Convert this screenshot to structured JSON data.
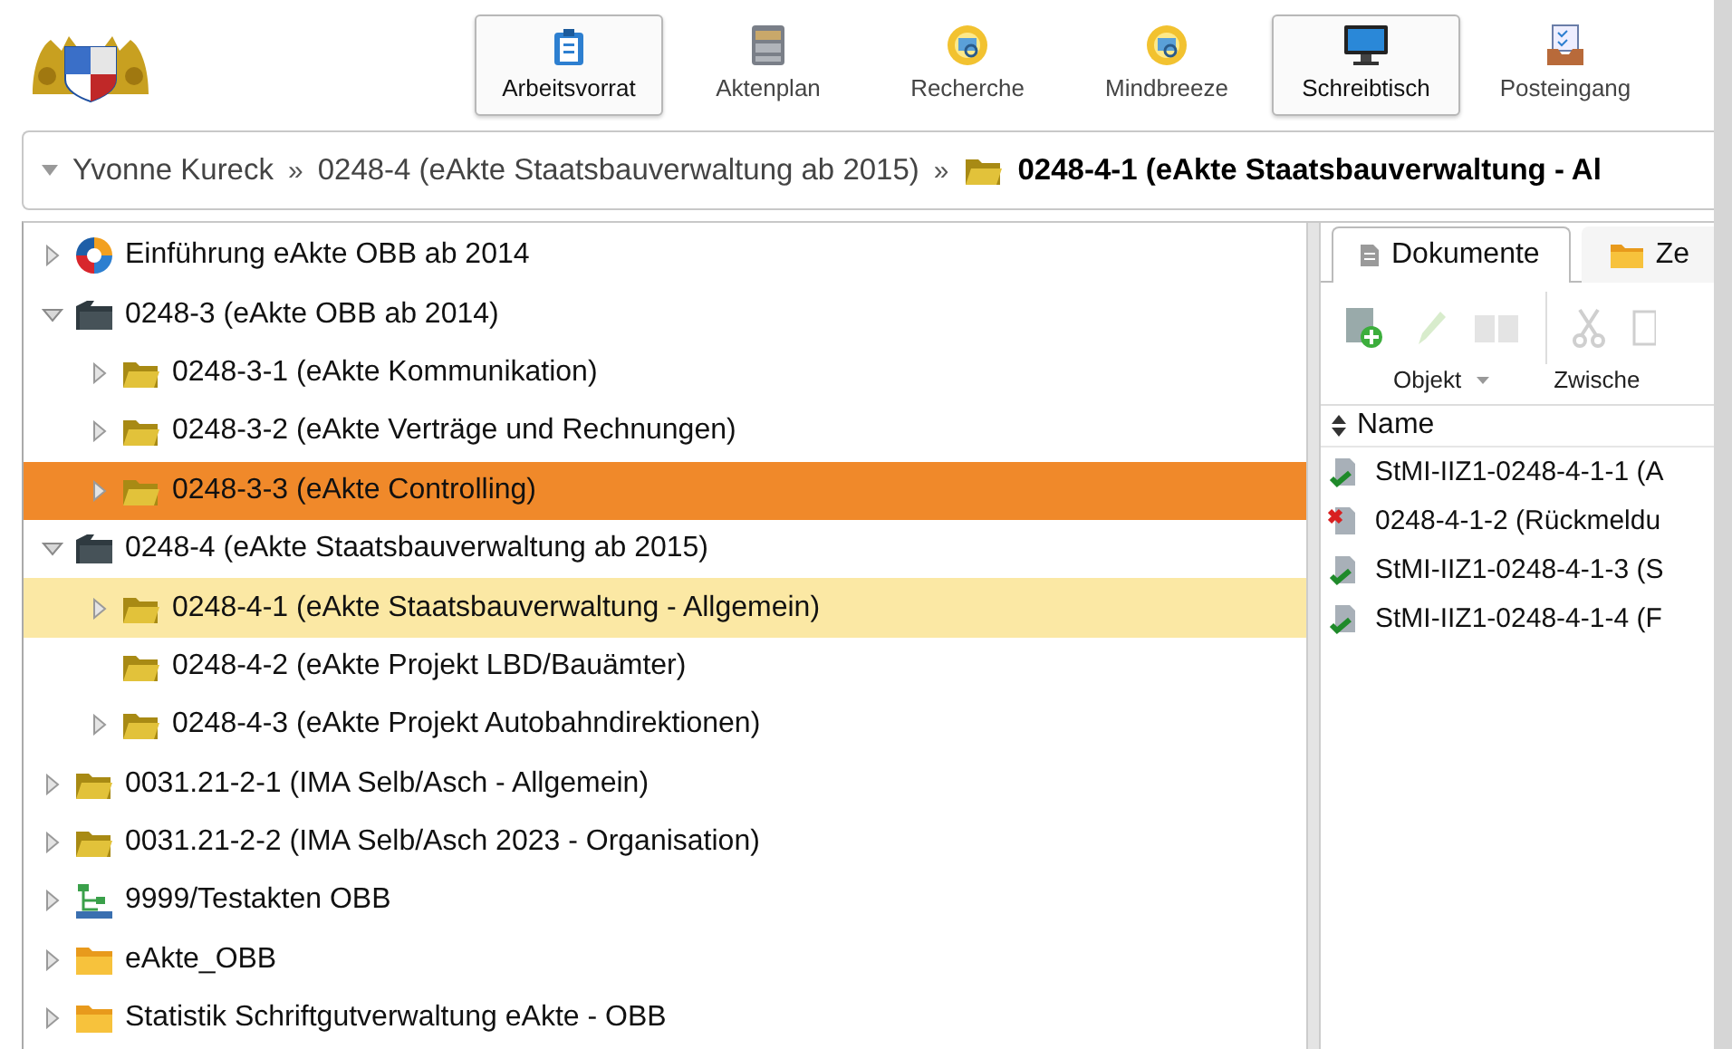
{
  "toolbar": [
    {
      "label": "Arbeitsvorrat",
      "kind": "clipboard",
      "selected": true
    },
    {
      "label": "Aktenplan",
      "kind": "cabinet",
      "selected": false
    },
    {
      "label": "Recherche",
      "kind": "search",
      "selected": false
    },
    {
      "label": "Mindbreeze",
      "kind": "search",
      "selected": false
    },
    {
      "label": "Schreibtisch",
      "kind": "monitor",
      "selected": true
    },
    {
      "label": "Posteingang",
      "kind": "inbox",
      "selected": false
    }
  ],
  "breadcrumb": {
    "parts": [
      {
        "label": "Yvonne Kureck",
        "current": false
      },
      {
        "label": "0248-4 (eAkte Staatsbauverwaltung ab 2015)",
        "current": false
      },
      {
        "label": "0248-4-1 (eAkte Staatsbauverwaltung - Al",
        "current": true
      }
    ],
    "separator": "»"
  },
  "tree": [
    {
      "label": "Einführung eAkte OBB ab 2014",
      "kind": "intro",
      "expanded": false,
      "selected": false,
      "highlighted": false
    },
    {
      "label": "0248-3 (eAkte OBB ab 2014)",
      "kind": "cabinet",
      "expanded": true,
      "selected": false,
      "highlighted": false,
      "children": [
        {
          "label": "0248-3-1 (eAkte Kommunikation)",
          "kind": "folder",
          "expanded": false,
          "selected": false,
          "highlighted": false
        },
        {
          "label": "0248-3-2 (eAkte Verträge und Rechnungen)",
          "kind": "folder",
          "expanded": false,
          "selected": false,
          "highlighted": false
        },
        {
          "label": "0248-3-3 (eAkte Controlling)",
          "kind": "folder",
          "expanded": false,
          "selected": true,
          "highlighted": false
        }
      ]
    },
    {
      "label": "0248-4 (eAkte Staatsbauverwaltung ab 2015)",
      "kind": "cabinet",
      "expanded": true,
      "selected": false,
      "highlighted": false,
      "children": [
        {
          "label": "0248-4-1 (eAkte Staatsbauverwaltung - Allgemein)",
          "kind": "folder",
          "expanded": false,
          "selected": false,
          "highlighted": true
        },
        {
          "label": "0248-4-2 (eAkte Projekt LBD/Bauämter)",
          "kind": "folder",
          "selected": false,
          "highlighted": false
        },
        {
          "label": "0248-4-3 (eAkte Projekt Autobahndirektionen)",
          "kind": "folder",
          "expanded": false,
          "selected": false,
          "highlighted": false
        }
      ]
    },
    {
      "label": "0031.21-2-1 (IMA Selb/Asch - Allgemein)",
      "kind": "folder",
      "expanded": false,
      "selected": false,
      "highlighted": false
    },
    {
      "label": "0031.21-2-2 (IMA Selb/Asch 2023 - Organisation)",
      "kind": "folder",
      "expanded": false,
      "selected": false,
      "highlighted": false
    },
    {
      "label": "9999/Testakten OBB",
      "kind": "network",
      "expanded": false,
      "selected": false,
      "highlighted": false
    },
    {
      "label": "eAkte_OBB",
      "kind": "orange-folder",
      "expanded": false,
      "selected": false,
      "highlighted": false
    },
    {
      "label": "Statistik Schriftgutverwaltung eAkte - OBB",
      "kind": "orange-folder",
      "expanded": false,
      "selected": false,
      "highlighted": false
    }
  ],
  "detail": {
    "tabs": [
      {
        "label": "Dokumente",
        "kind": "document",
        "selected": true
      },
      {
        "label": "Ze",
        "kind": "folder",
        "selected": false
      }
    ],
    "actions": [
      {
        "kind": "add",
        "disabled": false
      },
      {
        "kind": "pencil",
        "disabled": true
      },
      {
        "kind": "book",
        "disabled": true
      },
      {
        "kind": "scissors",
        "disabled": true
      },
      {
        "kind": "copy",
        "disabled": true
      }
    ],
    "groups": [
      {
        "label": "Objekt",
        "dropdown": true
      },
      {
        "label": "Zwische",
        "dropdown": false
      }
    ],
    "column": "Name",
    "documents": [
      {
        "name": "StMI-IIZ1-0248-4-1-1 (A",
        "kind": "ok"
      },
      {
        "name": "0248-4-1-2 (Rückmeldu",
        "kind": "error"
      },
      {
        "name": "StMI-IIZ1-0248-4-1-3 (S",
        "kind": "ok"
      },
      {
        "name": "StMI-IIZ1-0248-4-1-4 (F",
        "kind": "ok"
      }
    ]
  }
}
